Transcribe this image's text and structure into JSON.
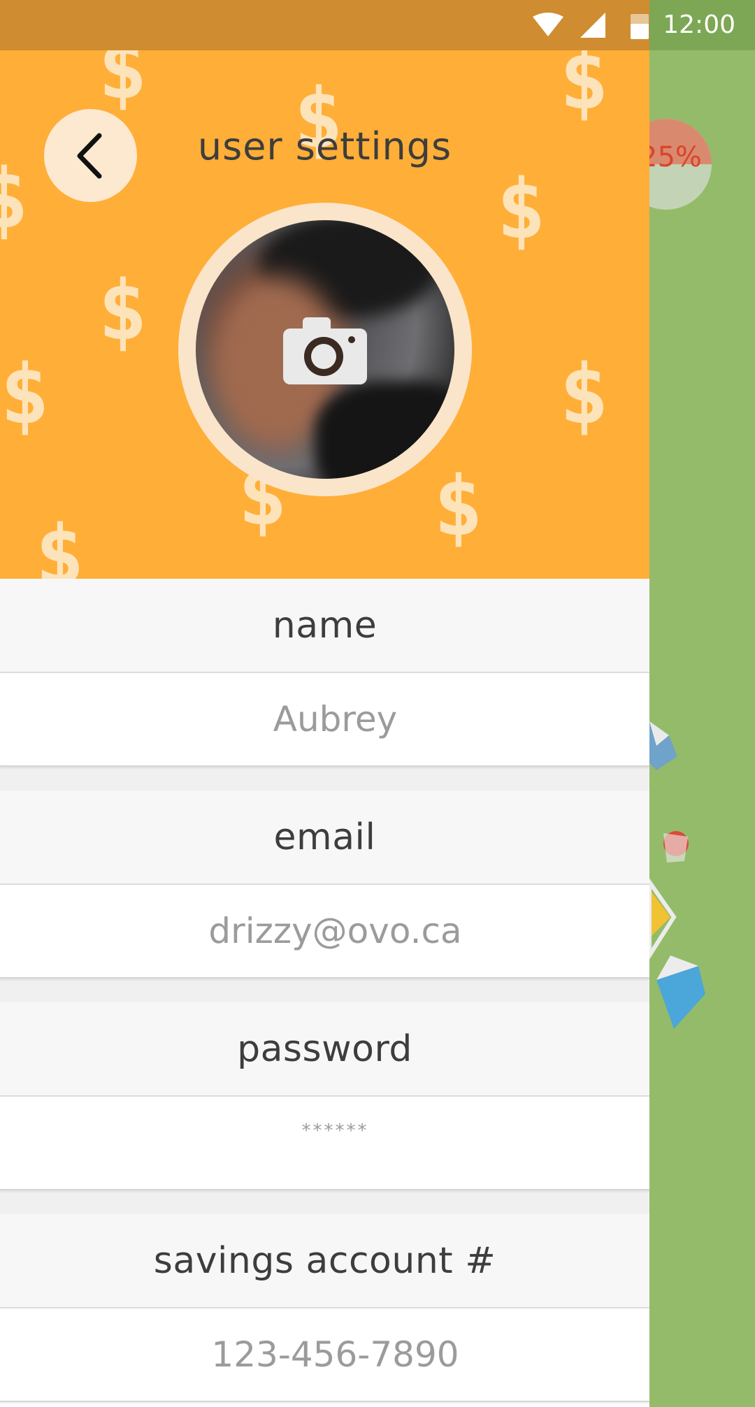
{
  "status_bar": {
    "time": "12:00",
    "icons": [
      "wifi-icon",
      "signal-icon",
      "battery-icon"
    ]
  },
  "background_app": {
    "progress_label": "25%",
    "progress_fraction": 0.25
  },
  "header": {
    "title": "user settings",
    "back_icon": "chevron-left-icon",
    "camera_icon": "camera-icon",
    "decoration_icon": "dollar-sign-icon"
  },
  "form": {
    "name": {
      "label": "name",
      "value": "Aubrey"
    },
    "email": {
      "label": "email",
      "value": "drizzy@ovo.ca"
    },
    "password": {
      "label": "password",
      "value": "******"
    },
    "savings": {
      "label": "savings account #",
      "value": "123-456-7890"
    }
  },
  "colors": {
    "header_bg": "#ffae38",
    "status_bar_bg": "#cf8c30",
    "background_app": "#94bb69",
    "text_dark": "#3d3d3d",
    "text_muted": "#9b9b9b"
  }
}
